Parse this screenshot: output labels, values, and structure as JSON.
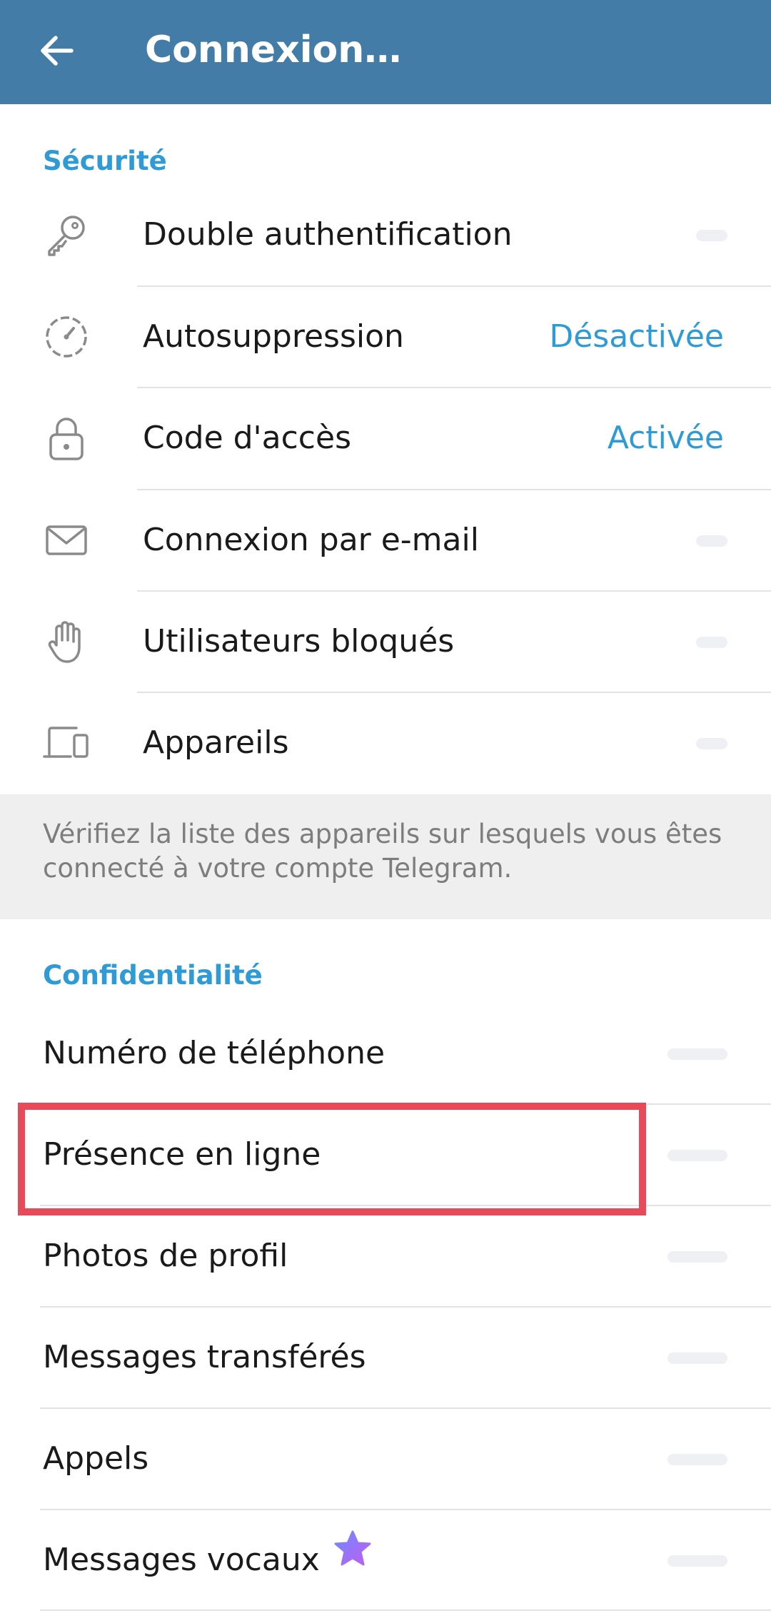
{
  "header": {
    "title": "Connexion…"
  },
  "security": {
    "section_title": "Sécurité",
    "items": [
      {
        "label": "Double authentification",
        "value": "",
        "icon": "key-icon"
      },
      {
        "label": "Autosuppression",
        "value": "Désactivée",
        "icon": "timer-icon"
      },
      {
        "label": "Code d'accès",
        "value": "Activée",
        "icon": "lock-icon"
      },
      {
        "label": "Connexion par e-mail",
        "value": "",
        "icon": "mail-icon"
      },
      {
        "label": "Utilisateurs bloqués",
        "value": "",
        "icon": "hand-icon"
      },
      {
        "label": "Appareils",
        "value": "",
        "icon": "devices-icon"
      }
    ],
    "footer": "Vérifiez la liste des appareils sur lesquels vous êtes connecté à votre compte Telegram."
  },
  "privacy": {
    "section_title": "Confidentialité",
    "items": [
      {
        "label": "Numéro de téléphone"
      },
      {
        "label": "Présence en ligne"
      },
      {
        "label": "Photos de profil"
      },
      {
        "label": "Messages transférés"
      },
      {
        "label": "Appels"
      },
      {
        "label": "Messages vocaux",
        "icon": "premium-star-icon"
      }
    ]
  },
  "colors": {
    "header_bg": "#447ca8",
    "accent": "#2e9bd6",
    "highlight": "#e84a5a",
    "premium_star": "#9b6cf5"
  }
}
